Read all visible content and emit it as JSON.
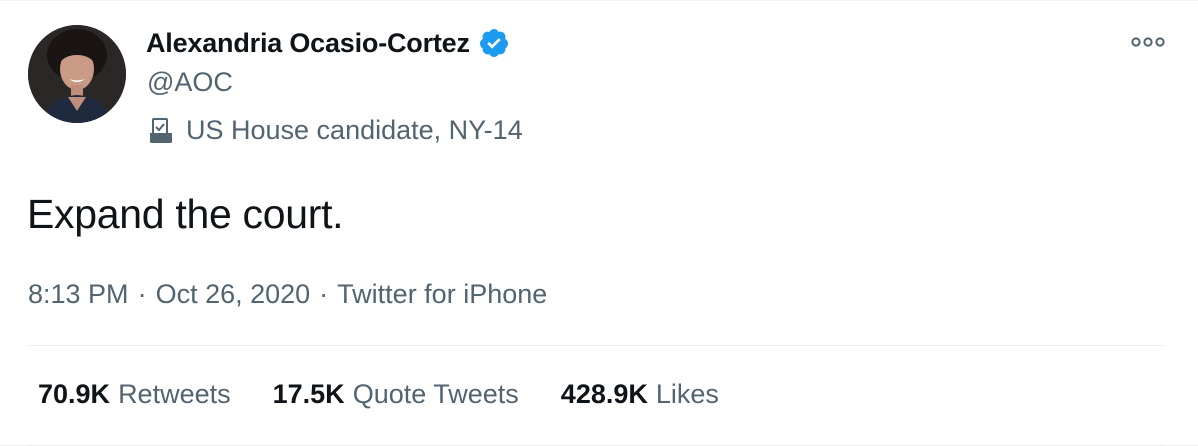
{
  "author": {
    "display_name": "Alexandria Ocasio-Cortez",
    "handle": "@AOC",
    "bio_label": "US House candidate, NY-14",
    "verified": true
  },
  "tweet": {
    "text": "Expand the court."
  },
  "meta": {
    "time": "8:13 PM",
    "date": "Oct 26, 2020",
    "source": "Twitter for iPhone",
    "separator": "·"
  },
  "stats": {
    "retweets_count": "70.9K",
    "retweets_label": "Retweets",
    "quotes_count": "17.5K",
    "quotes_label": "Quote Tweets",
    "likes_count": "428.9K",
    "likes_label": "Likes"
  },
  "colors": {
    "primary_text": "#0f1419",
    "secondary_text": "#536471",
    "verified_blue": "#1d9bf0",
    "divider": "#e6ecf0"
  },
  "icons": {
    "verified": "verified-badge-icon",
    "ballot": "ballot-box-icon",
    "more": "more-options-icon"
  }
}
